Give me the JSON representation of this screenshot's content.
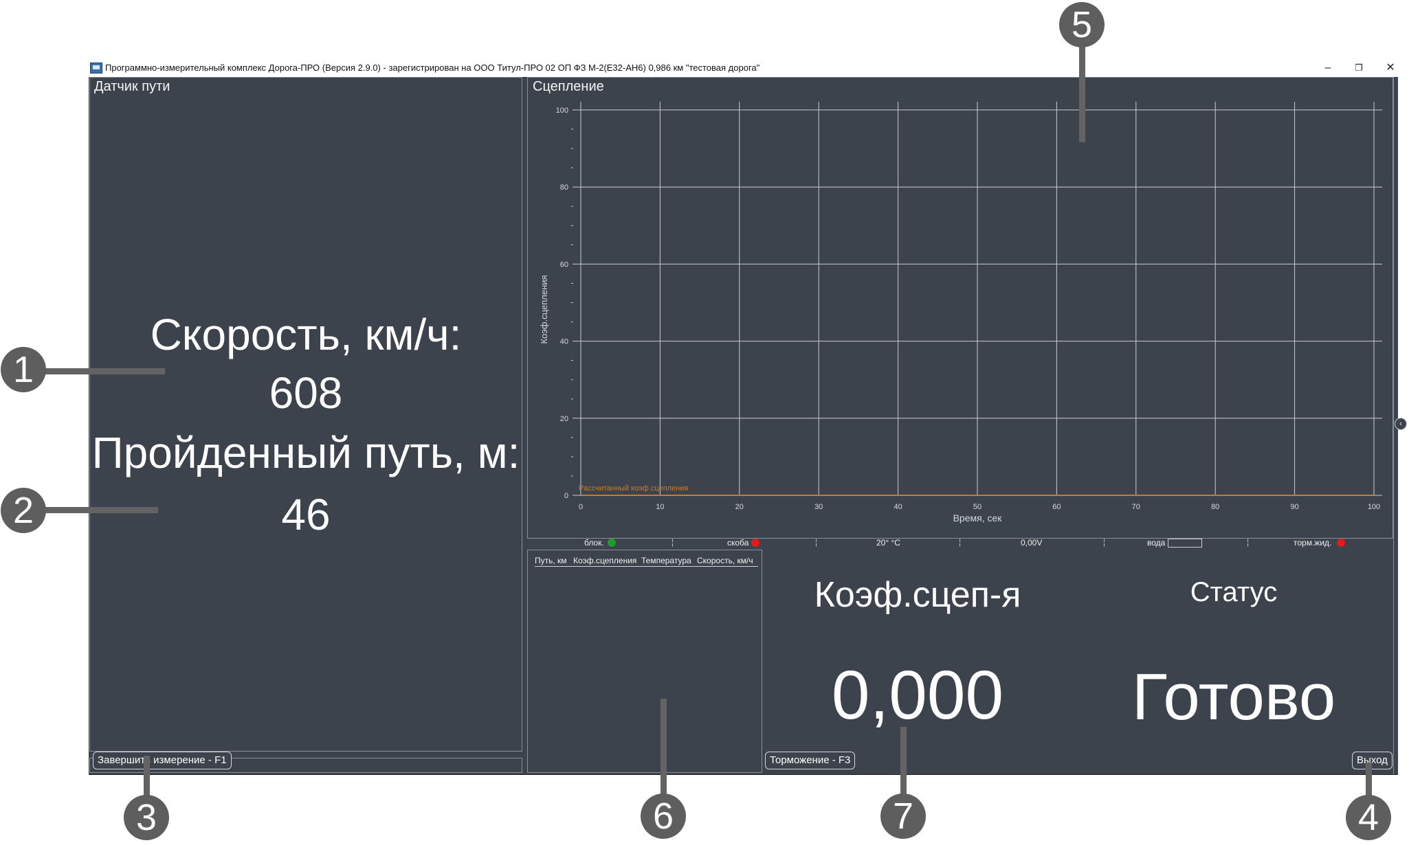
{
  "window": {
    "title": "Программно-измерительный комплекс Дорога-ПРО (Версия 2.9.0) - зарегистрирован на ООО Титул-ПРО 02 ОП ФЗ М-2(Е32-АН6) 0,986 км \"тестовая дорога\"",
    "minimize_glyph": "–",
    "maximize_glyph": "❐",
    "close_glyph": "✕"
  },
  "path_panel": {
    "title": "Датчик пути",
    "speed_label": "Скорость, км/ч:",
    "speed_value": "608",
    "distance_label": "Пройденный путь, м:",
    "distance_value": "46"
  },
  "grip_panel": {
    "title": "Сцепление"
  },
  "chart_data": {
    "type": "line",
    "title": "",
    "xlabel": "Время, сек",
    "ylabel": "Коэф.сцепления",
    "xlim": [
      0,
      100
    ],
    "ylim": [
      0,
      100
    ],
    "x_ticks": [
      0,
      10,
      20,
      30,
      40,
      50,
      60,
      70,
      80,
      90,
      100
    ],
    "y_ticks": [
      0,
      20,
      40,
      60,
      80,
      100
    ],
    "grid": true,
    "series": [
      {
        "name": "Рассчитанный коэф.сцепления",
        "color": "#d47a1e",
        "x": [
          0,
          100
        ],
        "y": [
          0,
          0
        ]
      }
    ],
    "legend_position": "bottom-left"
  },
  "status_row": {
    "block_label": "блок.",
    "block_color": "#1f9b2e",
    "clamp_label": "скоба",
    "clamp_color": "#e11b1b",
    "temperature": "20° °C",
    "voltage": "0,00V",
    "water_label": "вода",
    "brake_fluid_label": "торм.жид.",
    "brake_fluid_color": "#e11b1b",
    "separator": "¦"
  },
  "table": {
    "columns": [
      "Путь, км",
      "Коэф.сцепления",
      "Температура",
      "Скорость, км/ч"
    ],
    "rows": []
  },
  "readouts": {
    "coef_label": "Коэф.сцеп-я",
    "coef_value": "0,000",
    "status_label": "Статус",
    "status_value": "Готово"
  },
  "buttons": {
    "finish": "Завершить измерение - F1",
    "brake": "Торможение - F3",
    "exit": "Выход"
  },
  "collapse_glyph": "‹",
  "callouts": [
    "1",
    "2",
    "3",
    "4",
    "5",
    "6",
    "7"
  ]
}
